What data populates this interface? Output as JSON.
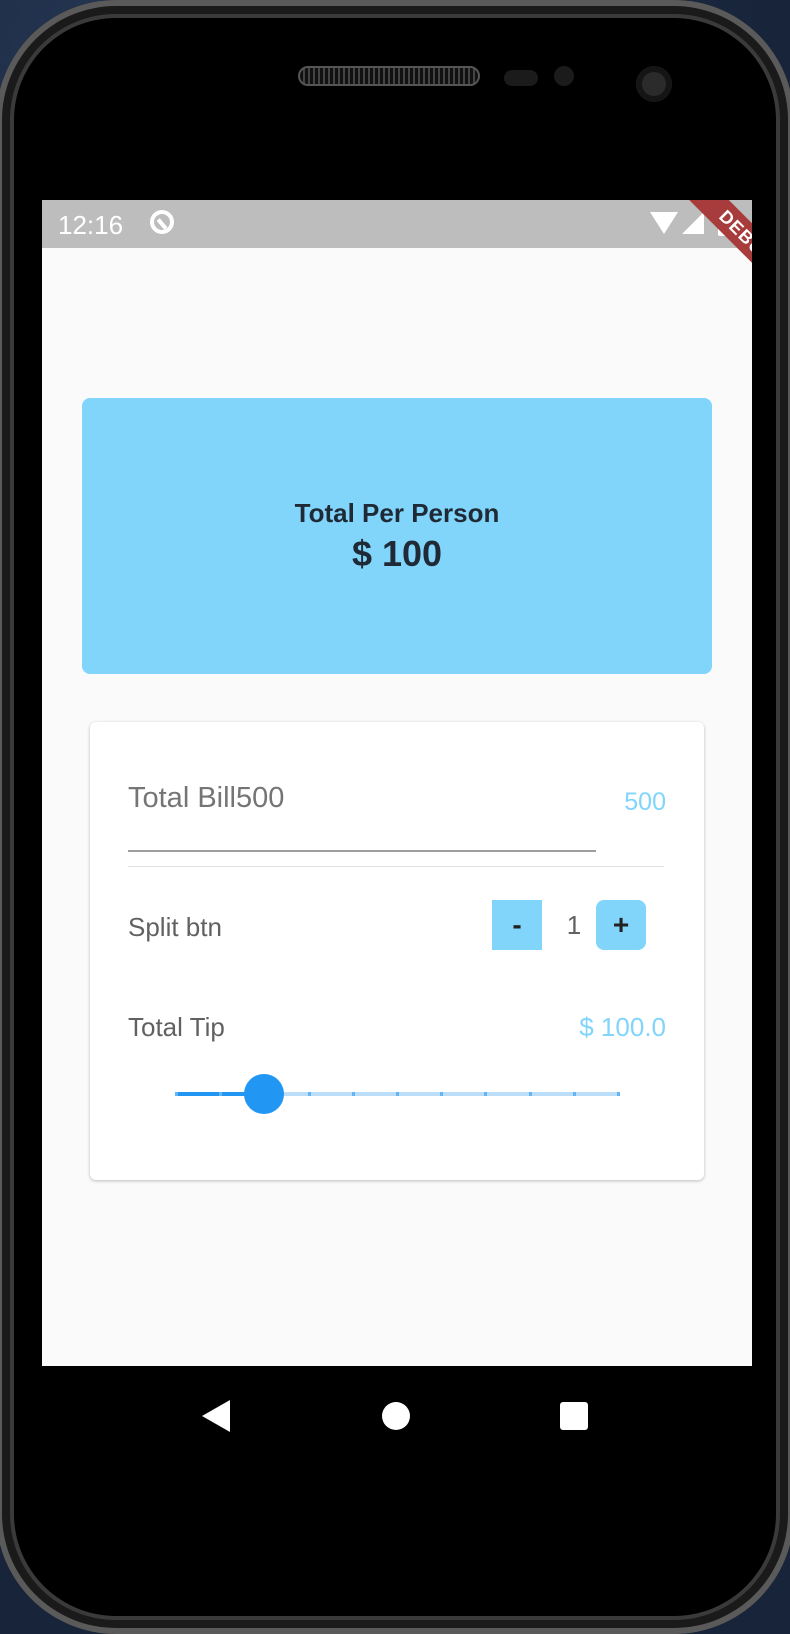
{
  "status_bar": {
    "time": "12:16",
    "debug_label": "DEBUG"
  },
  "summary": {
    "label": "Total Per Person",
    "amount": "$ 100",
    "color": "#81d5fb"
  },
  "bill": {
    "label": "Total Bill",
    "value": "500",
    "echo": "500"
  },
  "split": {
    "label": "Split btn",
    "minus_label": "-",
    "count": "1",
    "plus_label": "+"
  },
  "tip": {
    "label": "Total Tip",
    "value": "$ 100.0",
    "slider_fraction": 0.2,
    "slider_divisions": 10
  },
  "icons": {
    "status": [
      "wifi-icon",
      "signal-icon",
      "battery-icon"
    ],
    "nav": [
      "back-icon",
      "home-icon",
      "recents-icon"
    ]
  }
}
